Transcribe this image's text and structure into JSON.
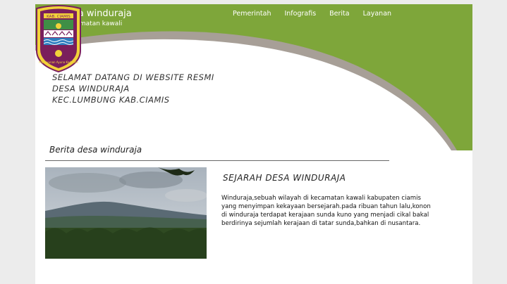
{
  "brand": {
    "title": "Desa winduraja",
    "subtitle": "kecamatan kawali"
  },
  "nav": {
    "items": [
      "Pemerintah",
      "Infografis",
      "Berita",
      "Layanan"
    ]
  },
  "hero": {
    "lines": [
      "SELAMAT DATANG DI WEBSITE RESMI",
      "DESA WINDURAJA",
      "KEC.LUMBUNG KAB.CIAMIS"
    ]
  },
  "crest": {
    "top_text": "KAB. CIAMIS",
    "bottom_text": "Mahayunan Ayuna Kadalina"
  },
  "news": {
    "section_title": "Berita desa winduraja",
    "article_title": "SEJARAH DESA WINDURAJA",
    "article_body": "Winduraja,sebuah wilayah di kecamatan kawali kabupaten ciamis yang menyimpan kekayaan bersejarah.pada ribuan tahun lalu,konon di winduraja terdapat kerajaan sunda kuno yang menjadi cikal bakal berdirinya sejumlah kerajaan di tatar sunda,bahkan di nusantara."
  },
  "colors": {
    "green": "#7ea63a",
    "swoosh": "#a79f97",
    "background": "#ececec"
  }
}
